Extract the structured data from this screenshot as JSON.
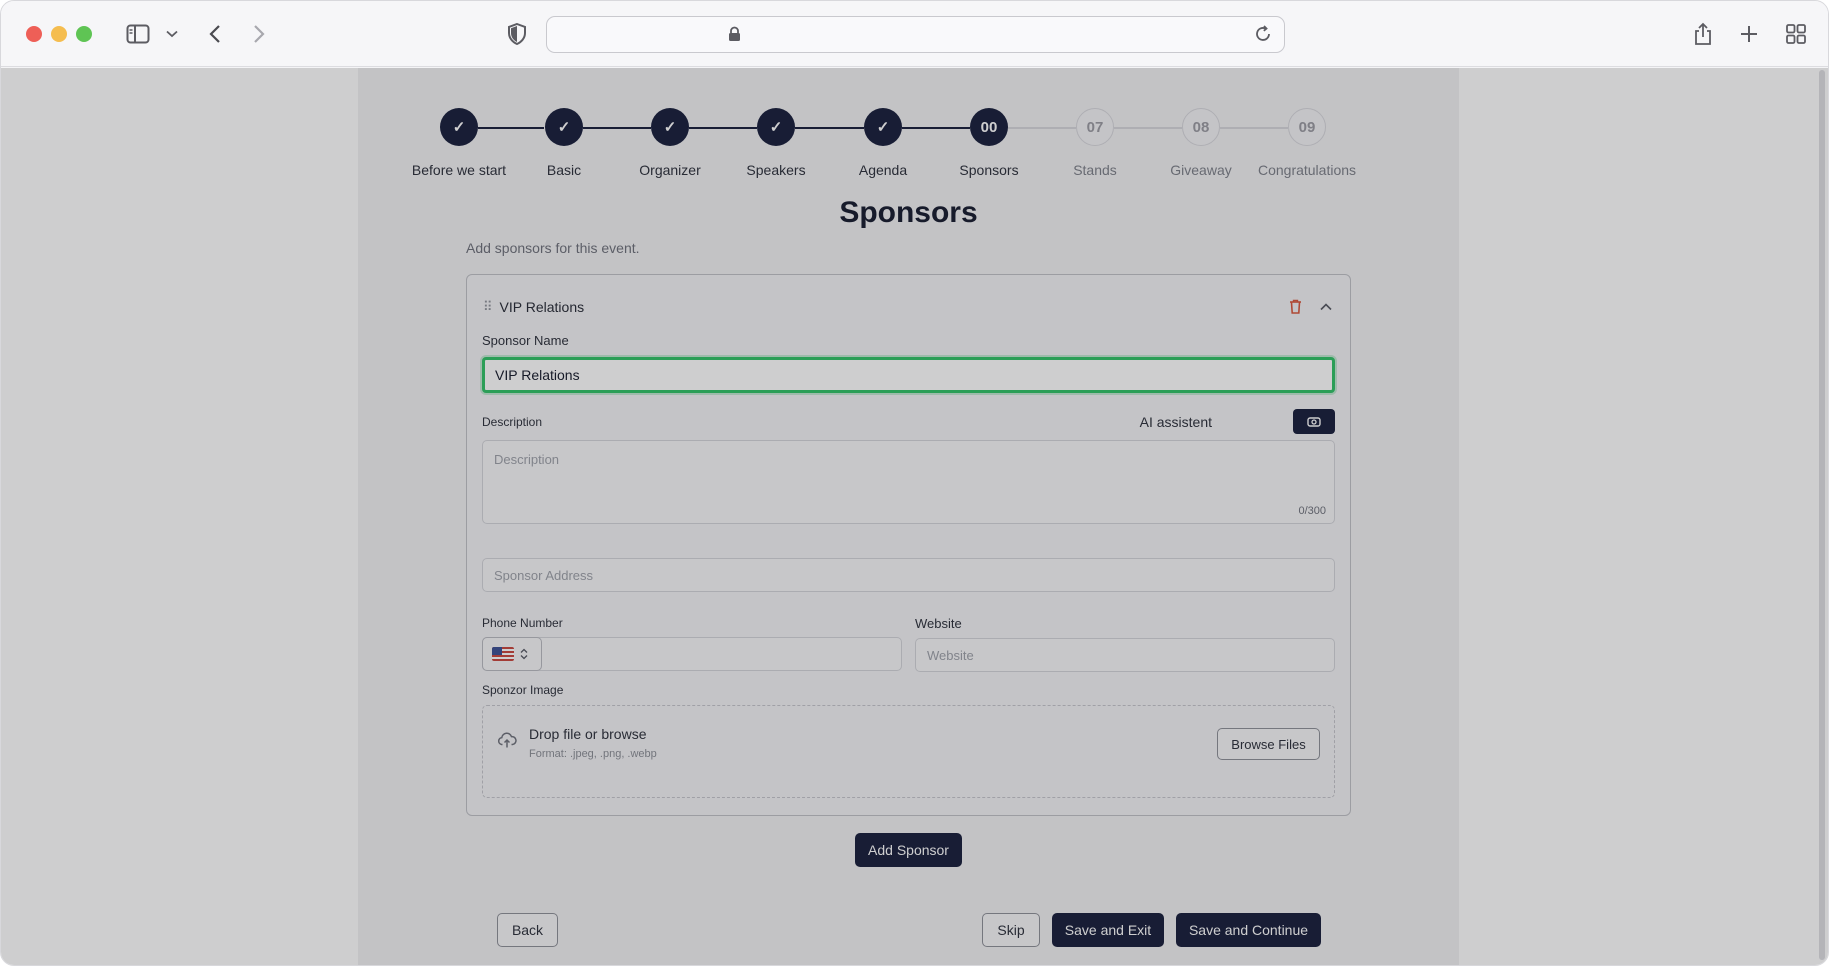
{
  "browser": {
    "url": ""
  },
  "stepper": {
    "steps": [
      {
        "label": "Before we start",
        "state": "done",
        "marker": "✓"
      },
      {
        "label": "Basic",
        "state": "done",
        "marker": "✓"
      },
      {
        "label": "Organizer",
        "state": "done",
        "marker": "✓"
      },
      {
        "label": "Speakers",
        "state": "done",
        "marker": "✓"
      },
      {
        "label": "Agenda",
        "state": "done",
        "marker": "✓"
      },
      {
        "label": "Sponsors",
        "state": "active",
        "marker": "00"
      },
      {
        "label": "Stands",
        "state": "todo",
        "marker": "07"
      },
      {
        "label": "Giveaway",
        "state": "todo",
        "marker": "08"
      },
      {
        "label": "Congratulations",
        "state": "todo",
        "marker": "09"
      }
    ]
  },
  "page": {
    "title": "Sponsors",
    "subtitle": "Add sponsors for this event."
  },
  "sponsor_card": {
    "header_title": "VIP Relations",
    "name_label": "Sponsor Name",
    "name_value": "VIP Relations",
    "description_label": "Description",
    "ai_label": "AI assistent",
    "description_placeholder": "Description",
    "description_count": "0/300",
    "address_placeholder": "Sponsor Address",
    "phone_label": "Phone Number",
    "phone_value": "",
    "website_label": "Website",
    "website_placeholder": "Website",
    "image_label": "Sponzor Image",
    "drop_title": "Drop file or browse",
    "drop_format": "Format: .jpeg, .png, .webp",
    "browse_label": "Browse Files"
  },
  "actions": {
    "add_sponsor": "Add Sponsor",
    "back": "Back",
    "skip": "Skip",
    "save_exit": "Save and Exit",
    "save_continue": "Save and Continue"
  },
  "colors": {
    "primary": "#161d3a",
    "focus_ring": "#2fc266",
    "danger": "#d8553a"
  }
}
